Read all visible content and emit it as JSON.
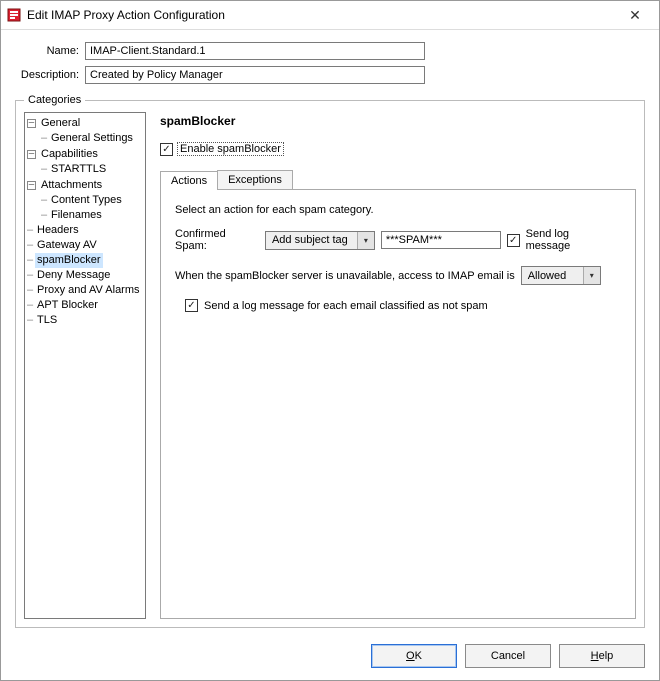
{
  "window": {
    "title": "Edit IMAP Proxy Action Configuration"
  },
  "form": {
    "name_label": "Name:",
    "name_value": "IMAP-Client.Standard.1",
    "desc_label": "Description:",
    "desc_value": "Created by Policy Manager"
  },
  "categories": {
    "legend": "Categories",
    "tree": {
      "general": "General",
      "general_settings": "General Settings",
      "capabilities": "Capabilities",
      "starttls": "STARTTLS",
      "attachments": "Attachments",
      "content_types": "Content Types",
      "filenames": "Filenames",
      "headers": "Headers",
      "gateway_av": "Gateway AV",
      "spamblocker": "spamBlocker",
      "deny_message": "Deny Message",
      "proxy_av_alarms": "Proxy and AV Alarms",
      "apt_blocker": "APT Blocker",
      "tls": "TLS"
    }
  },
  "panel": {
    "title": "spamBlocker",
    "enable_label": "Enable spamBlocker",
    "enable_checked": true,
    "tabs": {
      "actions": "Actions",
      "exceptions": "Exceptions"
    },
    "instructions": "Select an action for each spam category.",
    "confirmed_label": "Confirmed Spam:",
    "confirmed_action": "Add subject tag",
    "confirmed_tag": "***SPAM***",
    "send_log_label": "Send log message",
    "send_log_checked": true,
    "unavailable_text": "When the spamBlocker server is unavailable, access to IMAP email is",
    "unavailable_value": "Allowed",
    "not_spam_log_label": "Send a log message for each email classified as not spam",
    "not_spam_log_checked": true
  },
  "buttons": {
    "ok": "OK",
    "cancel": "Cancel",
    "help": "Help"
  }
}
